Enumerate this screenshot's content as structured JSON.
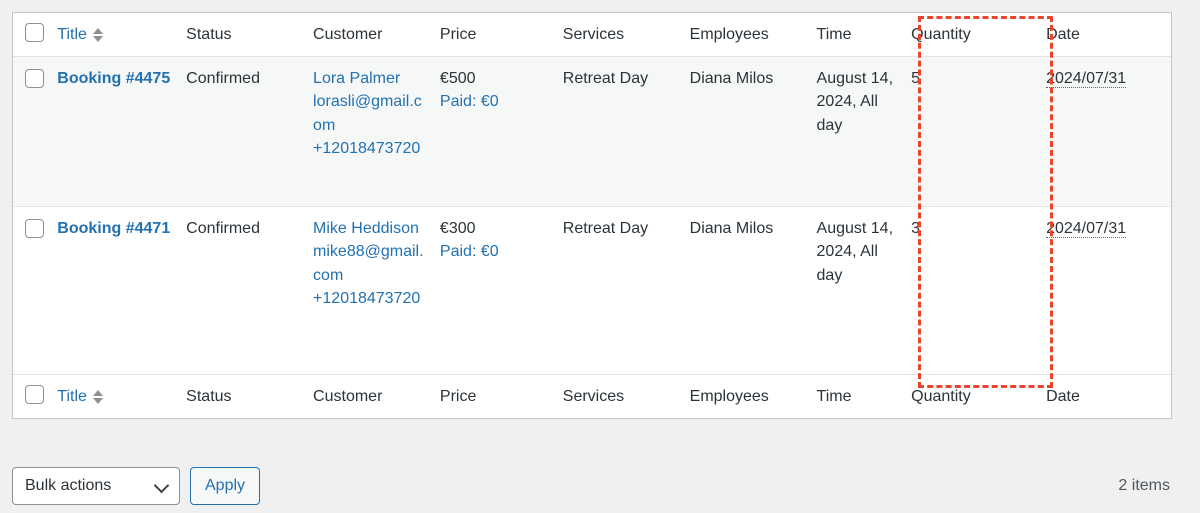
{
  "table": {
    "columns": [
      {
        "key": "cb",
        "label": "",
        "sortable": false
      },
      {
        "key": "title",
        "label": "Title",
        "sortable": true
      },
      {
        "key": "status",
        "label": "Status",
        "sortable": false
      },
      {
        "key": "customer",
        "label": "Customer",
        "sortable": false
      },
      {
        "key": "price",
        "label": "Price",
        "sortable": false
      },
      {
        "key": "services",
        "label": "Services",
        "sortable": false
      },
      {
        "key": "employees",
        "label": "Employees",
        "sortable": false
      },
      {
        "key": "time",
        "label": "Time",
        "sortable": false
      },
      {
        "key": "quantity",
        "label": "Quantity",
        "sortable": false
      },
      {
        "key": "date",
        "label": "Date",
        "sortable": false
      }
    ],
    "headers": {
      "title": "Title",
      "status": "Status",
      "customer": "Customer",
      "price": "Price",
      "services": "Services",
      "employees": "Employees",
      "time": "Time",
      "quantity": "Quantity",
      "date": "Date"
    },
    "rows": [
      {
        "title": "Booking #4475",
        "status": "Confirmed",
        "customer_name": "Lora Palmer",
        "customer_email": "lorasli@gmail.com",
        "customer_phone": "+12018473720",
        "price": "€500",
        "paid": "Paid: €0",
        "services": "Retreat Day",
        "employees": "Diana Milos",
        "time": "August 14, 2024, All day",
        "quantity": "5",
        "date": "2024/07/31"
      },
      {
        "title": "Booking #4471",
        "status": "Confirmed",
        "customer_name": "Mike Heddison",
        "customer_email": "mike88@gmail.com",
        "customer_phone": "+12018473720",
        "price": "€300",
        "paid": "Paid: €0",
        "services": "Retreat Day",
        "employees": "Diana Milos",
        "time": "August 14, 2024, All day",
        "quantity": "3",
        "date": "2024/07/31"
      }
    ]
  },
  "tablenav": {
    "bulk_actions_label": "Bulk actions",
    "apply_label": "Apply",
    "items_count": "2 items"
  },
  "highlight": {
    "target_column": "Quantity",
    "color": "#e8452c"
  }
}
